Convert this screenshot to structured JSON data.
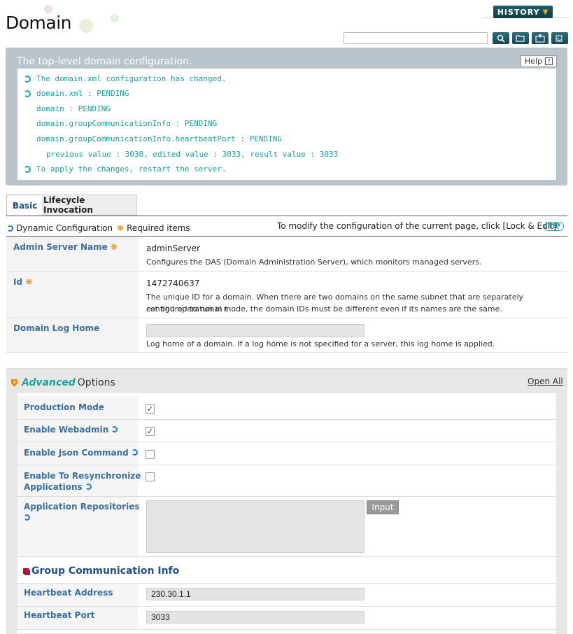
{
  "header": {
    "title": "Domain",
    "history_label": "HISTORY"
  },
  "message": {
    "title": "The top-level domain configuration.",
    "help_label": "Help",
    "lines": [
      "The domain.xml configuration has changed.",
      "domain.xml : PENDING",
      "domain : PENDING",
      "domain.groupCommunicationInfo : PENDING",
      "domain.groupCommunicationInfo.heartbeatPort : PENDING",
      "previous value : 3030, edited value : 3033, result value : 3033",
      "To apply the changes, restart the server."
    ]
  },
  "tabs": [
    {
      "label": "Basic",
      "active": true
    },
    {
      "label": "Lifecycle Invocation",
      "active": false
    }
  ],
  "legend": {
    "dynamic": "Dynamic Configuration",
    "required": "Required items",
    "note": "To modify the configuration of the current page, click [Lock & Edit].",
    "tip": "TIP"
  },
  "basic": {
    "admin_server_name": {
      "label": "Admin Server Name",
      "value": "adminServer",
      "desc": "Configures the DAS (Domain Administration Server), which monitors managed servers."
    },
    "id": {
      "label": "Id",
      "value": "1472740637",
      "desc1": "The unique ID for a domain. When there are two domains on the same subnet that are separately configured to run in t",
      "desc2": "est and operational mode, the domain IDs must be different even if its names are the same."
    },
    "domain_log_home": {
      "label": "Domain Log Home",
      "value": "",
      "desc": "Log home of a domain. If a log home is not specified for a server, this log home is applied."
    }
  },
  "advanced": {
    "title_italic": "Advanced",
    "title_rest": "Options",
    "open_all": "Open All",
    "production_mode": {
      "label": "Production Mode",
      "checked": true
    },
    "enable_webadmin": {
      "label": "Enable Webadmin",
      "checked": true
    },
    "enable_json": {
      "label": "Enable Json Command",
      "checked": false
    },
    "enable_resync": {
      "label1": "Enable To Resynchronize",
      "label2": "Applications",
      "checked": false
    },
    "app_repos": {
      "label": "Application Repositories",
      "input_label": "Input"
    },
    "group_comm": {
      "title": "Group Communication Info",
      "heartbeat_address": {
        "label": "Heartbeat Address",
        "value": "230.30.1.1"
      },
      "heartbeat_port": {
        "label": "Heartbeat Port",
        "value": "3033"
      }
    }
  },
  "icons": {
    "search": "search-icon",
    "folder": "open-folder-icon",
    "xml": "xml-export-icon",
    "refresh": "refresh-icon"
  },
  "colors": {
    "accent": "#1aa3a3",
    "label_blue": "#3a6fa3",
    "header_dark": "#174752"
  }
}
